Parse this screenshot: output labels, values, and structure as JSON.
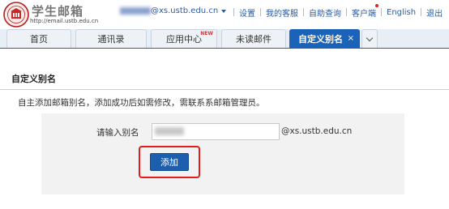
{
  "header": {
    "logo_title": "学生邮箱",
    "logo_url": "http://email.ustb.edu.cn",
    "account_domain": "@xs.ustb.edu.cn",
    "links": [
      "设置",
      "我的客服",
      "自助查询",
      "客户端",
      "English",
      "退出"
    ]
  },
  "tabs": [
    {
      "label": "首页"
    },
    {
      "label": "通讯录"
    },
    {
      "label": "应用中心",
      "badge": "NEW"
    },
    {
      "label": "未读邮件"
    },
    {
      "label": "自定义别名",
      "close": "×"
    }
  ],
  "page": {
    "title": "自定义别名",
    "description": "自主添加邮箱别名，添加成功后如需修改，需联系系邮箱管理员。",
    "form": {
      "label": "请输入别名",
      "input_value": "",
      "suffix": "@xs.ustb.edu.cn",
      "submit_label": "添加"
    }
  },
  "colors": {
    "accent": "#1b63b8",
    "button": "#1c5fae",
    "highlight": "#e31d1d",
    "notification_dot": "#e02020"
  },
  "icons": {
    "logo": "ustb-emblem-icon",
    "account_dropdown": "caret-down-icon",
    "tab_overflow": "chevron-down-icon",
    "tab_close": "close-icon"
  }
}
